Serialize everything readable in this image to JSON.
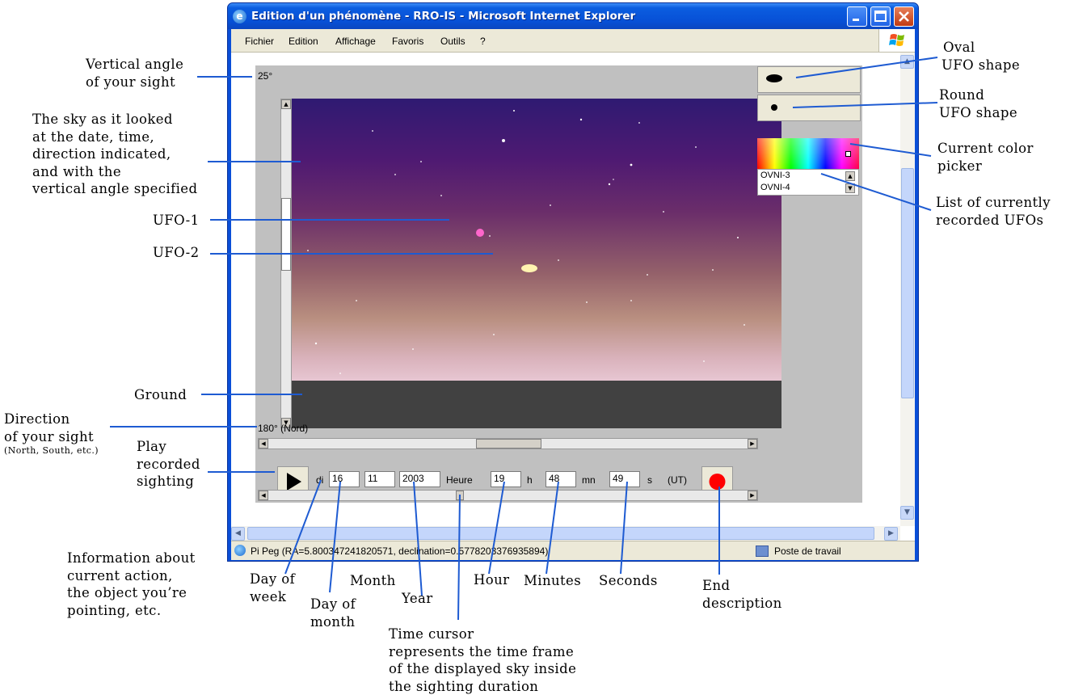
{
  "window": {
    "title": "Edition d'un phénomène - RRO-IS - Microsoft Internet Explorer"
  },
  "menu": [
    {
      "label": "Fichier"
    },
    {
      "label": "Edition"
    },
    {
      "label": "Affichage"
    },
    {
      "label": "Favoris"
    },
    {
      "label": "Outils"
    },
    {
      "label": "?"
    }
  ],
  "applet": {
    "vertical_angle": "25°",
    "direction": "180° (Nord)",
    "sky_colors": {
      "top": "#2f1a72",
      "bottom": "#e7c6d2",
      "ground": "#414141"
    },
    "ufo_list": [
      "OVNI-3",
      "OVNI-4"
    ],
    "ufo1_color": "#ff66cc",
    "ufo2_color": "#fff3b0"
  },
  "controls": {
    "day_of_week": "di",
    "day": "16",
    "month": "11",
    "year": "2003",
    "heure_label": "Heure",
    "hour": "19",
    "h_label": "h",
    "minutes": "48",
    "mn_label": "mn",
    "seconds": "49",
    "s_label": "s",
    "ut_label": "(UT)"
  },
  "status": {
    "text": "Pi Peg (RA=5.800347241820571, declination=0.5778203376935894)",
    "zone": "Poste de travail"
  },
  "annotations": {
    "vertical_angle": [
      "Vertical angle",
      "of your sight"
    ],
    "sky": [
      "The sky as it looked",
      "at the date, time,",
      "direction indicated,",
      "and with the",
      "vertical angle specified"
    ],
    "ufo1": "UFO-1",
    "ufo2": "UFO-2",
    "ground": "Ground",
    "direction": [
      "Direction",
      "of your sight"
    ],
    "direction_note": "(North, South, etc.)",
    "play": [
      "Play",
      "recorded",
      "sighting"
    ],
    "info": [
      "Information about",
      "current action,",
      "the object you’re",
      "pointing, etc."
    ],
    "day_of_week": [
      "Day of",
      "week"
    ],
    "day_of_month": [
      "Day of",
      "month"
    ],
    "month": "Month",
    "year": "Year",
    "hour": "Hour",
    "minutes": "Minutes",
    "seconds": "Seconds",
    "time_cursor": [
      "Time cursor",
      "represents the time frame",
      "of the displayed sky inside",
      "the sighting duration"
    ],
    "end": [
      "End",
      "description"
    ],
    "oval": [
      "Oval",
      "UFO shape"
    ],
    "round": [
      "Round",
      "UFO shape"
    ],
    "color_picker": [
      "Current color",
      "picker"
    ],
    "ufo_list": [
      "List of currently",
      "recorded UFOs"
    ]
  }
}
